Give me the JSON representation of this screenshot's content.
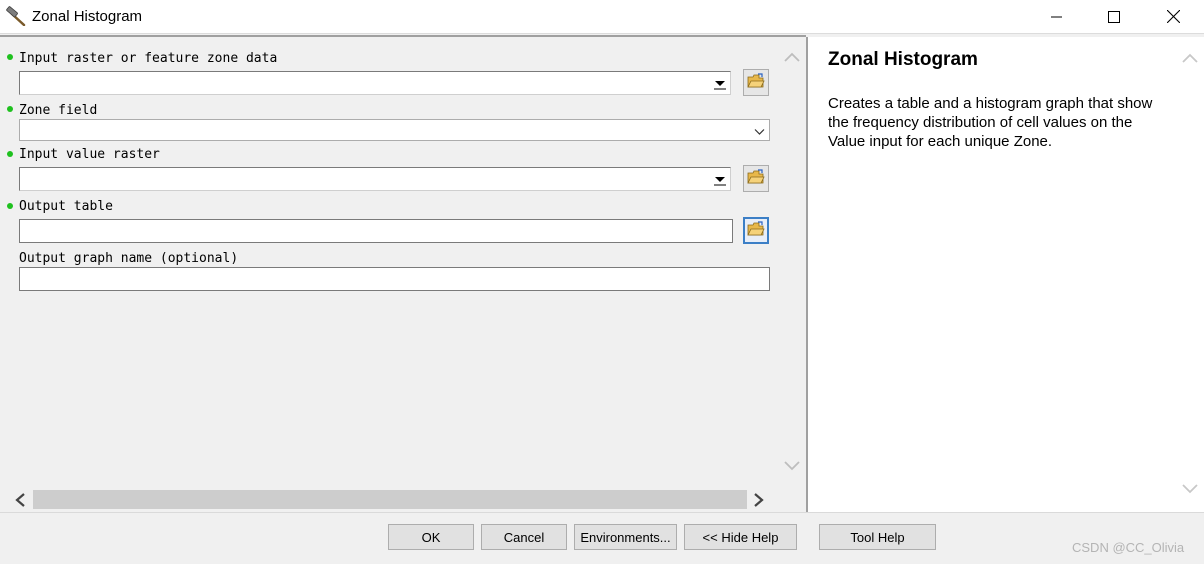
{
  "window": {
    "title": "Zonal Histogram",
    "app_icon": "hammer-icon"
  },
  "form": {
    "input_zone": {
      "label": "Input raster or feature zone data",
      "value": "",
      "required": true
    },
    "zone_field": {
      "label": "Zone field",
      "value": "",
      "required": true
    },
    "input_value": {
      "label": "Input value raster",
      "value": "",
      "required": true
    },
    "output_table": {
      "label": "Output table",
      "value": "",
      "required": true
    },
    "output_graph": {
      "label": "Output graph name (optional)",
      "value": "",
      "required": false
    }
  },
  "help": {
    "title": "Zonal Histogram",
    "description": "Creates a table and a histogram graph that show the frequency distribution of cell values on the Value input for each unique Zone."
  },
  "buttons": {
    "ok": "OK",
    "cancel": "Cancel",
    "environments": "Environments...",
    "hide_help": "<< Hide Help",
    "tool_help": "Tool Help"
  },
  "watermark": "CSDN @CC_Olivia",
  "colors": {
    "required_dot": "#1fc11f",
    "focus_border": "#3c7fc6",
    "folder_yellow": "#e8b84a"
  }
}
